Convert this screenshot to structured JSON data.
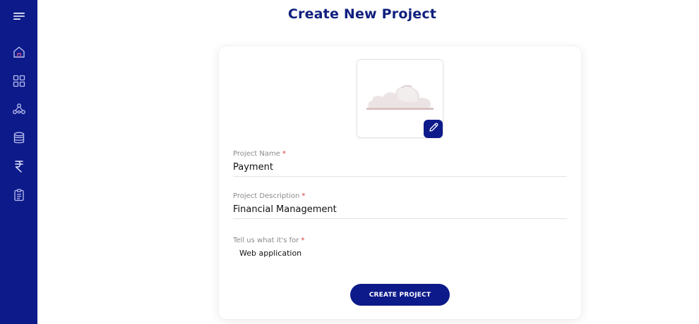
{
  "colors": {
    "sidebar": "#0d1a8a",
    "title": "#10207e",
    "primary_button": "#0d1a8a",
    "required_marker": "#dd3333",
    "label": "#8a8a8a"
  },
  "sidebar": {
    "items": [
      {
        "icon": "menu-icon"
      },
      {
        "icon": "home-icon"
      },
      {
        "icon": "grid-icon"
      },
      {
        "icon": "network-icon"
      },
      {
        "icon": "database-icon"
      },
      {
        "icon": "rupee-icon"
      },
      {
        "icon": "clipboard-icon"
      }
    ]
  },
  "page": {
    "title": "Create New Project"
  },
  "form": {
    "image": {
      "icon": "cloud-placeholder-icon",
      "edit_icon": "pencil-icon"
    },
    "project_name": {
      "label": "Project Name",
      "required_mark": "*",
      "value": "Payment"
    },
    "project_description": {
      "label": "Project Description",
      "required_mark": "*",
      "value": "Financial Management"
    },
    "purpose": {
      "label": "Tell us what it's for",
      "required_mark": "*",
      "value": "Web application"
    },
    "submit_label": "CREATE PROJECT"
  }
}
